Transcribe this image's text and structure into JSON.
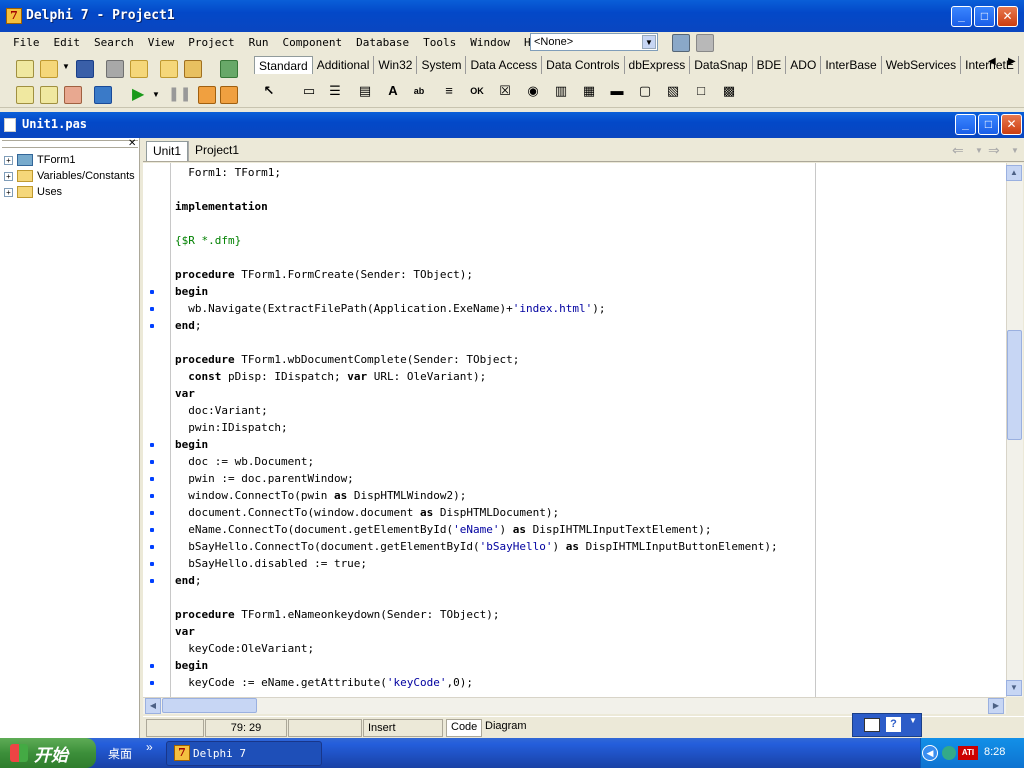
{
  "window": {
    "title": "Delphi 7 - Project1",
    "minimize": "_",
    "maximize": "□",
    "close": "✕"
  },
  "menu": [
    "File",
    "Edit",
    "Search",
    "View",
    "Project",
    "Run",
    "Component",
    "Database",
    "Tools",
    "Window",
    "Help"
  ],
  "combo": {
    "value": "<None>",
    "arrow": "▼"
  },
  "palette_tabs": [
    "Standard",
    "Additional",
    "Win32",
    "System",
    "Data Access",
    "Data Controls",
    "dbExpress",
    "DataSnap",
    "BDE",
    "ADO",
    "InterBase",
    "WebServices",
    "InternetE"
  ],
  "palette_scroll": {
    "left": "◀",
    "right": "▶"
  },
  "palette_icons": [
    {
      "name": "pointer-icon",
      "glyph": "↖"
    },
    {
      "name": "frame-icon",
      "glyph": "▭"
    },
    {
      "name": "mainmenu-icon",
      "glyph": "☰"
    },
    {
      "name": "popupmenu-icon",
      "glyph": "▤"
    },
    {
      "name": "label-icon",
      "glyph": "A"
    },
    {
      "name": "edit-icon",
      "glyph": "ab"
    },
    {
      "name": "memo-icon",
      "glyph": "≡"
    },
    {
      "name": "button-icon",
      "glyph": "OK"
    },
    {
      "name": "checkbox-icon",
      "glyph": "☒"
    },
    {
      "name": "radiobutton-icon",
      "glyph": "◉"
    },
    {
      "name": "listbox-icon",
      "glyph": "▥"
    },
    {
      "name": "combobox-icon",
      "glyph": "▦"
    },
    {
      "name": "scrollbar-icon",
      "glyph": "▬"
    },
    {
      "name": "groupbox-icon",
      "glyph": "▢"
    },
    {
      "name": "radiogroup-icon",
      "glyph": "▧"
    },
    {
      "name": "panel-icon",
      "glyph": "□"
    },
    {
      "name": "actionlist-icon",
      "glyph": "▩"
    }
  ],
  "editor": {
    "title": "Unit1.pas",
    "tabs": [
      "Unit1",
      "Project1"
    ],
    "nav": {
      "back": "⇐",
      "forward": "⇒"
    }
  },
  "tree": [
    {
      "label": "TForm1",
      "kind": "form"
    },
    {
      "label": "Variables/Constants",
      "kind": "folder"
    },
    {
      "label": "Uses",
      "kind": "folder"
    }
  ],
  "tree_close": "✕",
  "tree_expand": "+",
  "code_lines": [
    {
      "segs": [
        {
          "t": "  Form1: TForm1;"
        }
      ],
      "dot": false
    },
    {
      "segs": [
        {
          "t": ""
        }
      ],
      "dot": false
    },
    {
      "segs": [
        {
          "t": "implementation",
          "c": "kw"
        }
      ],
      "dot": false
    },
    {
      "segs": [
        {
          "t": ""
        }
      ],
      "dot": false
    },
    {
      "segs": [
        {
          "t": "{$R *.dfm}",
          "c": "cmt"
        }
      ],
      "dot": false
    },
    {
      "segs": [
        {
          "t": ""
        }
      ],
      "dot": false
    },
    {
      "segs": [
        {
          "t": "procedure",
          "c": "kw"
        },
        {
          "t": " TForm1.FormCreate(Sender: TObject);"
        }
      ],
      "dot": false
    },
    {
      "segs": [
        {
          "t": "begin",
          "c": "kw"
        }
      ],
      "dot": true
    },
    {
      "segs": [
        {
          "t": "  wb.Navigate(ExtractFilePath(Application.ExeName)+"
        },
        {
          "t": "'index.html'",
          "c": "str"
        },
        {
          "t": ");"
        }
      ],
      "dot": true
    },
    {
      "segs": [
        {
          "t": "end",
          "c": "kw"
        },
        {
          "t": ";"
        }
      ],
      "dot": true
    },
    {
      "segs": [
        {
          "t": ""
        }
      ],
      "dot": false
    },
    {
      "segs": [
        {
          "t": "procedure",
          "c": "kw"
        },
        {
          "t": " TForm1.wbDocumentComplete(Sender: TObject;"
        }
      ],
      "dot": false
    },
    {
      "segs": [
        {
          "t": "  "
        },
        {
          "t": "const",
          "c": "kw"
        },
        {
          "t": " pDisp: IDispatch; "
        },
        {
          "t": "var",
          "c": "kw"
        },
        {
          "t": " URL: OleVariant);"
        }
      ],
      "dot": false
    },
    {
      "segs": [
        {
          "t": "var",
          "c": "kw"
        }
      ],
      "dot": false
    },
    {
      "segs": [
        {
          "t": "  doc:Variant;"
        }
      ],
      "dot": false
    },
    {
      "segs": [
        {
          "t": "  pwin:IDispatch;"
        }
      ],
      "dot": false
    },
    {
      "segs": [
        {
          "t": "begin",
          "c": "kw"
        }
      ],
      "dot": true
    },
    {
      "segs": [
        {
          "t": "  doc := wb.Document;"
        }
      ],
      "dot": true
    },
    {
      "segs": [
        {
          "t": "  pwin := doc.parentWindow;"
        }
      ],
      "dot": true
    },
    {
      "segs": [
        {
          "t": "  window.ConnectTo(pwin "
        },
        {
          "t": "as",
          "c": "kw"
        },
        {
          "t": " DispHTMLWindow2);"
        }
      ],
      "dot": true
    },
    {
      "segs": [
        {
          "t": "  document.ConnectTo(window.document "
        },
        {
          "t": "as",
          "c": "kw"
        },
        {
          "t": " DispHTMLDocument);"
        }
      ],
      "dot": true
    },
    {
      "segs": [
        {
          "t": "  eName.ConnectTo(document.getElementById("
        },
        {
          "t": "'eName'",
          "c": "str"
        },
        {
          "t": ") "
        },
        {
          "t": "as",
          "c": "kw"
        },
        {
          "t": " DispIHTMLInputTextElement);"
        }
      ],
      "dot": true
    },
    {
      "segs": [
        {
          "t": "  bSayHello.ConnectTo(document.getElementById("
        },
        {
          "t": "'bSayHello'",
          "c": "str"
        },
        {
          "t": ") "
        },
        {
          "t": "as",
          "c": "kw"
        },
        {
          "t": " DispIHTMLInputButtonElement);"
        }
      ],
      "dot": true
    },
    {
      "segs": [
        {
          "t": "  bSayHello.disabled := true;"
        }
      ],
      "dot": true
    },
    {
      "segs": [
        {
          "t": "end",
          "c": "kw"
        },
        {
          "t": ";"
        }
      ],
      "dot": true
    },
    {
      "segs": [
        {
          "t": ""
        }
      ],
      "dot": false
    },
    {
      "segs": [
        {
          "t": "procedure",
          "c": "kw"
        },
        {
          "t": " TForm1.eNameonkeydown(Sender: TObject);"
        }
      ],
      "dot": false
    },
    {
      "segs": [
        {
          "t": "var",
          "c": "kw"
        }
      ],
      "dot": false
    },
    {
      "segs": [
        {
          "t": "  keyCode:OleVariant;"
        }
      ],
      "dot": false
    },
    {
      "segs": [
        {
          "t": "begin",
          "c": "kw"
        }
      ],
      "dot": true
    },
    {
      "segs": [
        {
          "t": "  keyCode := eName.getAttribute("
        },
        {
          "t": "'keyCode'",
          "c": "str"
        },
        {
          "t": ",0);"
        }
      ],
      "dot": true
    }
  ],
  "scroll": {
    "up": "▲",
    "down": "▼",
    "left": "◀",
    "right": "▶"
  },
  "status": {
    "position": "79: 29",
    "mode": "Insert",
    "tabs": [
      "Code",
      "Diagram"
    ]
  },
  "taskbar": {
    "start": "开始",
    "desktop": "桌面",
    "chevron": "»",
    "task": "Delphi 7",
    "time": "8:28",
    "ati": "ATI"
  }
}
